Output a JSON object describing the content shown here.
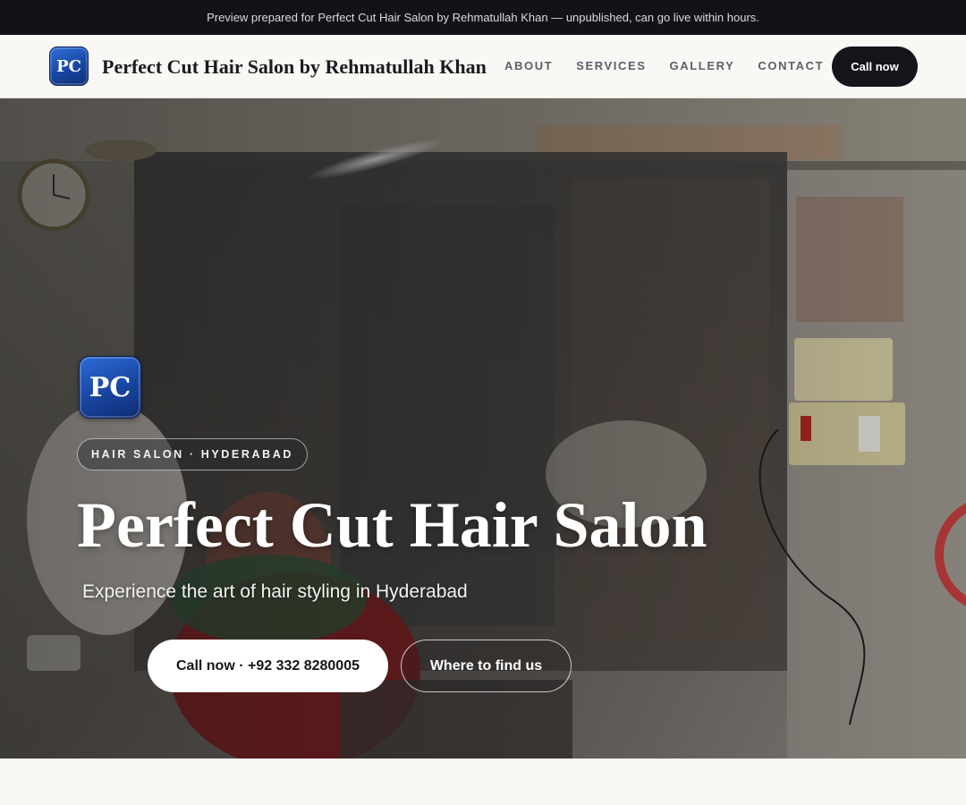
{
  "preview_banner": "Preview prepared for Perfect Cut Hair Salon by Rehmatullah Khan — unpublished, can go live within hours.",
  "nav": {
    "logo_text": "PC",
    "brand": "Perfect Cut Hair Salon by Rehmatullah Khan",
    "links": [
      "ABOUT",
      "SERVICES",
      "GALLERY",
      "CONTACT"
    ],
    "cta": "Call now"
  },
  "hero": {
    "logo_text": "PC",
    "badge": "HAIR SALON · HYDERABAD",
    "title": "Perfect Cut Hair Salon",
    "subtitle": "Experience the art of hair styling in Hyderabad",
    "primary_button": "Call now · +92 332 8280005",
    "secondary_button": "Where to find us"
  },
  "colors": {
    "topbar": "#111318",
    "nav_bg": "#f9f8f5",
    "dark_button": "#14161c",
    "logo_blue": "#1a4aa8"
  }
}
